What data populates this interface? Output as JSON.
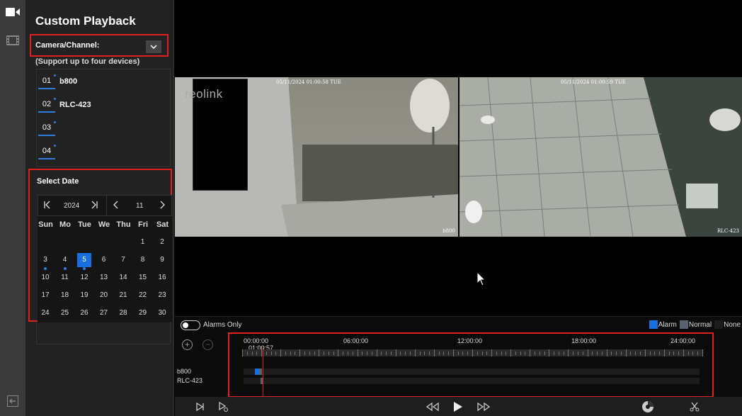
{
  "panel": {
    "title": "Custom Playback",
    "camera_label": "Camera/Channel:",
    "support_note": "(Support up to four devices)",
    "channels": [
      {
        "num": "01",
        "name": "b800"
      },
      {
        "num": "02",
        "name": "RLC-423"
      },
      {
        "num": "03",
        "name": ""
      },
      {
        "num": "04",
        "name": ""
      }
    ]
  },
  "calendar": {
    "title": "Select Date",
    "year": "2024",
    "month": "11",
    "weekdays": [
      "Sun",
      "Mo",
      "Tue",
      "We",
      "Thu",
      "Fri",
      "Sat"
    ],
    "selected_day": "5",
    "days_with_recordings": [
      "3",
      "4",
      "5"
    ],
    "days": [
      "1",
      "2",
      "3",
      "4",
      "5",
      "6",
      "7",
      "8",
      "9",
      "10",
      "11",
      "12",
      "13",
      "14",
      "15",
      "16",
      "17",
      "18",
      "19",
      "20",
      "21",
      "22",
      "23",
      "24",
      "25",
      "26",
      "27",
      "28",
      "29",
      "30"
    ]
  },
  "feeds": [
    {
      "osd": "05/11/2024 01:00:58 TUE",
      "name": "b800",
      "logo": "reolink"
    },
    {
      "osd": "05/11/2024 01:00:59 TUE",
      "name": "RLC-423"
    }
  ],
  "timeline": {
    "alarms_only_label": "Alarms Only",
    "legend": [
      {
        "label": "Alarm",
        "color": "#1a6fe0"
      },
      {
        "label": "Normal",
        "color": "#5a6270"
      },
      {
        "label": "None",
        "color": "#1c1c1c"
      }
    ],
    "ticks": [
      "00:00:00",
      "06:00:00",
      "12:00:00",
      "18:00:00",
      "24:00:00"
    ],
    "current_time": "01:00:57",
    "tracks": [
      {
        "name": "b800"
      },
      {
        "name": "RLC-423"
      }
    ]
  },
  "colors": {
    "accent": "#1a6fe0",
    "highlight": "#e0201c"
  }
}
